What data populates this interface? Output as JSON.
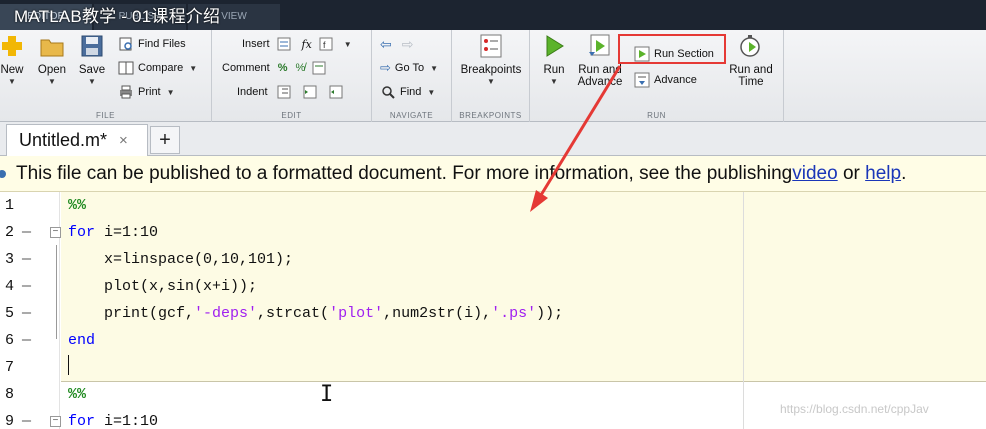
{
  "video_title": "MATLAB教学 - 01课程介绍",
  "ribbon_tabs": [
    "EDITOR",
    "PUBLISH",
    "VIEW"
  ],
  "ribbon": {
    "file": {
      "label": "FILE",
      "new": "New",
      "open": "Open",
      "save": "Save",
      "find_files": "Find Files",
      "compare": "Compare",
      "print": "Print"
    },
    "edit": {
      "label": "EDIT",
      "insert": "Insert",
      "comment": "Comment",
      "indent": "Indent"
    },
    "navigate": {
      "label": "NAVIGATE",
      "go_to": "Go To",
      "find": "Find"
    },
    "breakpoints": {
      "label": "BREAKPOINTS",
      "breakpoints": "Breakpoints"
    },
    "run": {
      "label": "RUN",
      "run": "Run",
      "run_and_advance_1": "Run and",
      "run_and_advance_2": "Advance",
      "run_section": "Run Section",
      "advance": "Advance",
      "run_and_time_1": "Run and",
      "run_and_time_2": "Time"
    }
  },
  "doc_tab": {
    "name": "Untitled.m",
    "modified": "*",
    "close": "×",
    "add": "+"
  },
  "info_bar": {
    "text": "This file can be published to a formatted document. For more information, see the publishing ",
    "video": "video",
    "or": " or ",
    "help": "help",
    "end": "."
  },
  "code_lines": [
    {
      "n": "1",
      "dash": "",
      "text": "%%"
    },
    {
      "n": "2",
      "dash": "—",
      "text": "for i=1:10"
    },
    {
      "n": "3",
      "dash": "—",
      "text": "    x=linspace(0,10,101);"
    },
    {
      "n": "4",
      "dash": "—",
      "text": "    plot(x,sin(x+i));"
    },
    {
      "n": "5",
      "dash": "—",
      "text": "    print(gcf,'-deps',strcat('plot',num2str(i),'.ps'));"
    },
    {
      "n": "6",
      "dash": "—",
      "text": "end"
    },
    {
      "n": "7",
      "dash": "",
      "text": ""
    },
    {
      "n": "8",
      "dash": "",
      "text": "%%"
    },
    {
      "n": "9",
      "dash": "—",
      "text": "for i=1:10"
    }
  ],
  "watermark": "https://blog.csdn.net/cppJav",
  "colors": {
    "keyword": "#0000ff",
    "comment": "#228b22",
    "string": "#a020f0",
    "section_bg": "#fdfbe4",
    "highlight_box": "#e53935",
    "link": "#1a36b8"
  }
}
